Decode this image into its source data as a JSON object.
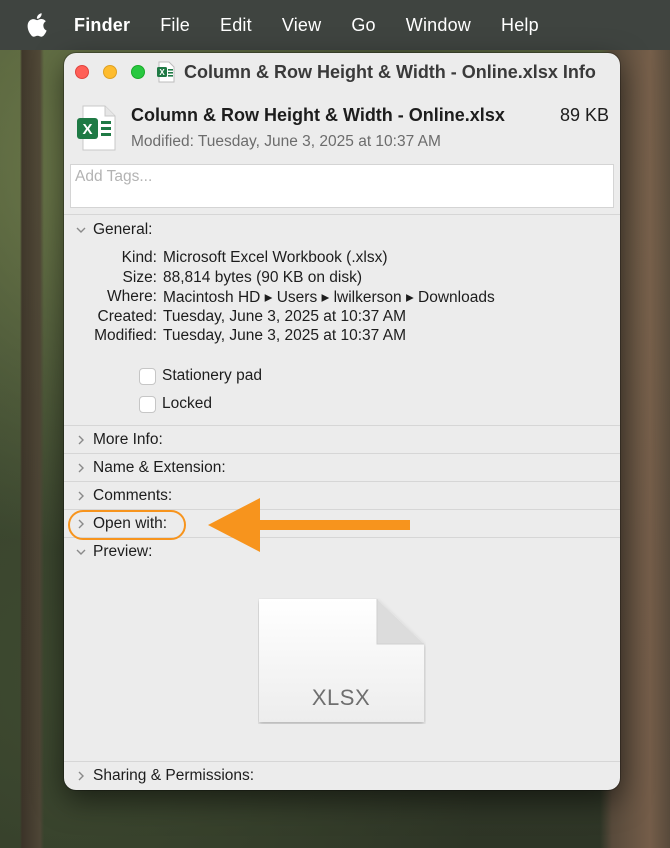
{
  "menubar": {
    "app": "Finder",
    "items": [
      "File",
      "Edit",
      "View",
      "Go",
      "Window",
      "Help"
    ]
  },
  "window": {
    "title": "Column & Row Height & Width - Online.xlsx Info"
  },
  "header": {
    "file_name": "Column & Row Height & Width - Online.xlsx",
    "file_size": "89 KB",
    "modified": "Modified: Tuesday, June 3, 2025 at 10:37 AM",
    "icon_letter": "X"
  },
  "tags": {
    "placeholder": "Add Tags..."
  },
  "general": {
    "label": "General:",
    "rows": [
      {
        "key": "Kind:",
        "value": "Microsoft Excel Workbook (.xlsx)"
      },
      {
        "key": "Size:",
        "value": "88,814 bytes (90 KB on disk)"
      },
      {
        "key": "Where:",
        "value": "Macintosh HD ▸ Users ▸ lwilkerson ▸ Downloads"
      },
      {
        "key": "Created:",
        "value": "Tuesday, June 3, 2025 at 10:37 AM"
      },
      {
        "key": "Modified:",
        "value": "Tuesday, June 3, 2025 at 10:37 AM"
      }
    ],
    "stationery_pad": "Stationery pad",
    "locked": "Locked"
  },
  "sections": {
    "more_info": "More Info:",
    "name_extension": "Name & Extension:",
    "comments": "Comments:",
    "open_with": "Open with:",
    "preview": "Preview:",
    "sharing": "Sharing & Permissions:"
  },
  "preview": {
    "doc_label": "XLSX"
  },
  "colors": {
    "accent_orange": "#f7941d",
    "excel_green": "#1f7a45",
    "close": "#ff5f57",
    "minimize": "#febc2e",
    "maximize": "#28c840"
  }
}
